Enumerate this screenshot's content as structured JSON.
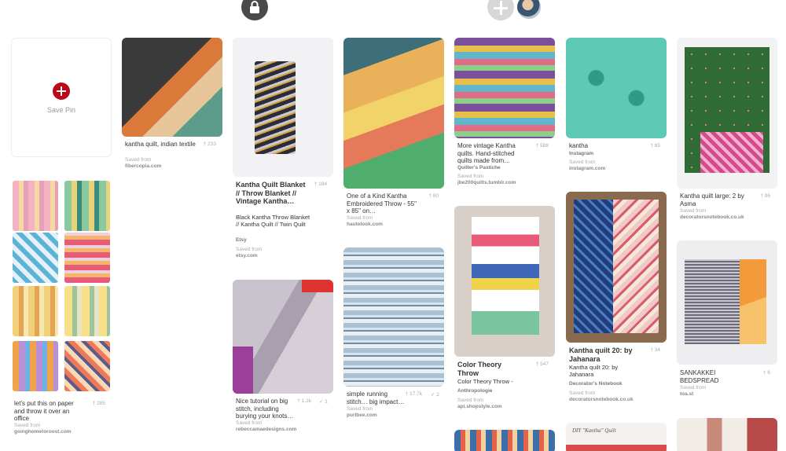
{
  "header": {
    "lock_icon": "lock-icon",
    "add_icon": "plus-icon",
    "avatar": "avatar"
  },
  "save_pin": {
    "label": "Save Pin"
  },
  "pins": [
    {
      "id": "p1",
      "title": "kantha quilt, indian textile",
      "count": "233",
      "saved_from": "Saved from",
      "url": "fibercopia.com"
    },
    {
      "id": "p2",
      "title": "Kantha Quilt Blanket // Throw Blanket // Vintage Kantha…",
      "count": "184",
      "desc": "Black Kantha Throw Blanket // Kantha Quilt // Twin Quilt",
      "source": "Etsy",
      "saved_from": "Saved from",
      "url": "etsy.com"
    },
    {
      "id": "p3",
      "title": "One of a Kind Kantha Embroidered Throw - 55\" x 85\" on…",
      "count": "80",
      "saved_from": "Saved from",
      "url": "hautelook.com"
    },
    {
      "id": "p4",
      "title": "More vintage Kantha quilts. Hand-stitched quilts made from…",
      "count": "588",
      "source": "Quilter's Pastiche",
      "saved_from": "Saved from",
      "url": "jbe200quilts.tumblr.com"
    },
    {
      "id": "p5",
      "title": "kantha",
      "count": "65",
      "source": "Instagram",
      "saved_from": "Saved from",
      "url": "instagram.com"
    },
    {
      "id": "p6",
      "title": "Kantha quilt large: 2 by Asma",
      "count": "96",
      "saved_from": "Saved from",
      "url": "decoratorsnotebook.co.uk"
    },
    {
      "id": "p7",
      "title": "let's put this on paper and throw it over an office",
      "count": "285",
      "saved_from": "Saved from",
      "url": "goinghometoroost.com"
    },
    {
      "id": "p8",
      "title": "Nice tutorial on big stitch, including burying your knots…",
      "count": "1.2k",
      "count2": "1",
      "saved_from": "Saved from",
      "url": "rebeccamaedesigns.com"
    },
    {
      "id": "p9",
      "title": "simple running stitch… big impact…",
      "count": "17.7k",
      "count2": "2",
      "saved_from": "Saved from",
      "url": "purlbee.com"
    },
    {
      "id": "p10",
      "title": "Color Theory Throw",
      "count": "547",
      "desc": "Color Theory Throw -",
      "source": "Anthropologie",
      "saved_from": "Saved from",
      "url": "api.shopstyle.com"
    },
    {
      "id": "p11",
      "title": "Kantha quilt 20: by Jahanara",
      "count": "34",
      "desc": "Kantha quilt 20: by Jahanara",
      "source": "Decorator's Notebook",
      "saved_from": "Saved from",
      "url": "decoratorsnotebook.co.uk"
    },
    {
      "id": "p12",
      "title": "SANKAKKEI BEDSPREAD",
      "count": "6",
      "saved_from": "Saved from",
      "url": "toa.st"
    },
    {
      "id": "p13",
      "title": "DIY \"Kantha\" Quilt"
    }
  ],
  "colors": {
    "brand_red": "#bd081c"
  }
}
